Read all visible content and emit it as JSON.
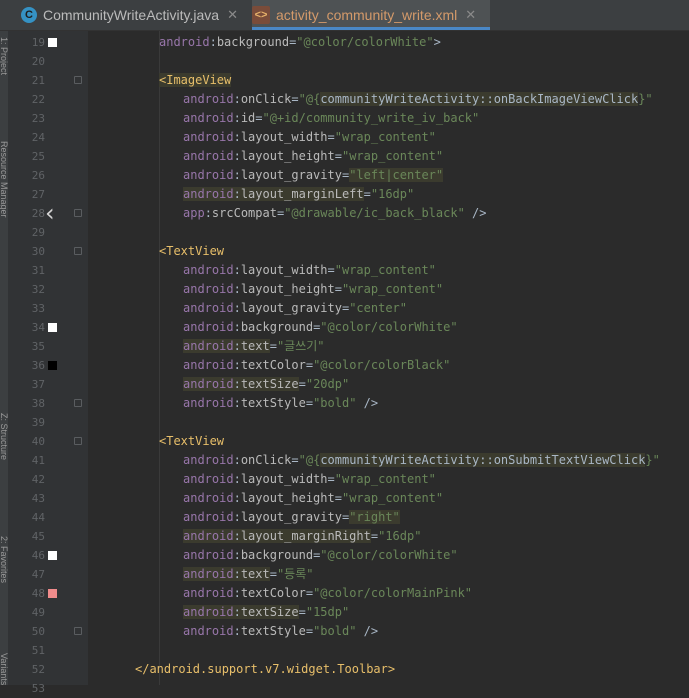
{
  "tabs": [
    {
      "label": "CommunityWriteActivity.java",
      "icon": "java-class-icon",
      "glyph": "C",
      "active": false
    },
    {
      "label": "activity_community_write.xml",
      "icon": "xml-layout-icon",
      "glyph": "<>",
      "active": true
    }
  ],
  "side_panel_labels": [
    "1: Project",
    "Resource Manager",
    "Z: Structure",
    "2: Favorites",
    "Variants"
  ],
  "colors": {
    "tag": "#e8bf6a",
    "namespace": "#9876aa",
    "attribute": "#bababa",
    "value": "#6a8759",
    "background": "#2b2b2b",
    "gutter": "#313335",
    "swatch_white": "#ffffff",
    "swatch_black": "#000000",
    "swatch_pink": "#f08c8c"
  },
  "lines": [
    {
      "num": "19",
      "indent": 2,
      "parts": [
        [
          "ns",
          "android"
        ],
        [
          "plain",
          ":"
        ],
        [
          "attr",
          "background"
        ],
        [
          "plain",
          "="
        ],
        [
          "val",
          "\"@color/colorWhite\""
        ],
        [
          "plain",
          ">"
        ]
      ],
      "swatch": "#ffffff",
      "fold": false
    },
    {
      "num": "20",
      "indent": 0,
      "parts": [],
      "fold": false
    },
    {
      "num": "21",
      "indent": 2,
      "parts": [
        [
          "tag",
          "<ImageView"
        ]
      ],
      "fold": true
    },
    {
      "num": "22",
      "indent": 3,
      "parts": [
        [
          "ns",
          "android"
        ],
        [
          "plain",
          ":"
        ],
        [
          "attr",
          "onClick"
        ],
        [
          "plain",
          "="
        ],
        [
          "val",
          "\"@{"
        ],
        [
          "plain",
          "communityWriteActivity::onBackImageViewClick"
        ],
        [
          "val",
          "}\""
        ]
      ],
      "fold": false
    },
    {
      "num": "23",
      "indent": 3,
      "parts": [
        [
          "ns",
          "android"
        ],
        [
          "plain",
          ":"
        ],
        [
          "attr",
          "id"
        ],
        [
          "plain",
          "="
        ],
        [
          "val",
          "\"@+id/community_write_iv_back\""
        ]
      ],
      "fold": false
    },
    {
      "num": "24",
      "indent": 3,
      "parts": [
        [
          "ns",
          "android"
        ],
        [
          "plain",
          ":"
        ],
        [
          "attr",
          "layout_width"
        ],
        [
          "plain",
          "="
        ],
        [
          "val",
          "\"wrap_content\""
        ]
      ],
      "fold": false
    },
    {
      "num": "25",
      "indent": 3,
      "parts": [
        [
          "ns",
          "android"
        ],
        [
          "plain",
          ":"
        ],
        [
          "attr",
          "layout_height"
        ],
        [
          "plain",
          "="
        ],
        [
          "val",
          "\"wrap_content\""
        ]
      ],
      "fold": false
    },
    {
      "num": "26",
      "indent": 3,
      "parts": [
        [
          "ns",
          "android"
        ],
        [
          "plain",
          ":"
        ],
        [
          "attr",
          "layout_gravity"
        ],
        [
          "plain",
          "="
        ],
        [
          "val",
          "\"left|center\""
        ]
      ],
      "fold": false
    },
    {
      "num": "27",
      "indent": 3,
      "parts": [
        [
          "ns",
          "android"
        ],
        [
          "plain",
          ":"
        ],
        [
          "attr",
          "layout_marginLeft"
        ],
        [
          "plain",
          "="
        ],
        [
          "val",
          "\"16dp\""
        ]
      ],
      "fold": false
    },
    {
      "num": "28",
      "indent": 3,
      "parts": [
        [
          "ns",
          "app"
        ],
        [
          "plain",
          ":"
        ],
        [
          "attr",
          "srcCompat"
        ],
        [
          "plain",
          "="
        ],
        [
          "val",
          "\"@drawable/ic_back_black\""
        ],
        [
          "plain",
          " />"
        ]
      ],
      "fold": true,
      "gutter_icon": "back-arrow-icon"
    },
    {
      "num": "29",
      "indent": 0,
      "parts": [],
      "fold": false
    },
    {
      "num": "30",
      "indent": 2,
      "parts": [
        [
          "tag",
          "<TextView"
        ]
      ],
      "fold": true
    },
    {
      "num": "31",
      "indent": 3,
      "parts": [
        [
          "ns",
          "android"
        ],
        [
          "plain",
          ":"
        ],
        [
          "attr",
          "layout_width"
        ],
        [
          "plain",
          "="
        ],
        [
          "val",
          "\"wrap_content\""
        ]
      ],
      "fold": false
    },
    {
      "num": "32",
      "indent": 3,
      "parts": [
        [
          "ns",
          "android"
        ],
        [
          "plain",
          ":"
        ],
        [
          "attr",
          "layout_height"
        ],
        [
          "plain",
          "="
        ],
        [
          "val",
          "\"wrap_content\""
        ]
      ],
      "fold": false
    },
    {
      "num": "33",
      "indent": 3,
      "parts": [
        [
          "ns",
          "android"
        ],
        [
          "plain",
          ":"
        ],
        [
          "attr",
          "layout_gravity"
        ],
        [
          "plain",
          "="
        ],
        [
          "val",
          "\"center\""
        ]
      ],
      "fold": false
    },
    {
      "num": "34",
      "indent": 3,
      "parts": [
        [
          "ns",
          "android"
        ],
        [
          "plain",
          ":"
        ],
        [
          "attr",
          "background"
        ],
        [
          "plain",
          "="
        ],
        [
          "val",
          "\"@color/colorWhite\""
        ]
      ],
      "swatch": "#ffffff",
      "fold": false
    },
    {
      "num": "35",
      "indent": 3,
      "parts": [
        [
          "ns",
          "android"
        ],
        [
          "plain",
          ":"
        ],
        [
          "attr",
          "text"
        ],
        [
          "plain",
          "="
        ],
        [
          "val",
          "\"글쓰기\""
        ]
      ],
      "fold": false
    },
    {
      "num": "36",
      "indent": 3,
      "parts": [
        [
          "ns",
          "android"
        ],
        [
          "plain",
          ":"
        ],
        [
          "attr",
          "textColor"
        ],
        [
          "plain",
          "="
        ],
        [
          "val",
          "\"@color/colorBlack\""
        ]
      ],
      "swatch": "#000000",
      "fold": false
    },
    {
      "num": "37",
      "indent": 3,
      "parts": [
        [
          "ns",
          "android"
        ],
        [
          "plain",
          ":"
        ],
        [
          "attr",
          "textSize"
        ],
        [
          "plain",
          "="
        ],
        [
          "val",
          "\"20dp\""
        ]
      ],
      "fold": false
    },
    {
      "num": "38",
      "indent": 3,
      "parts": [
        [
          "ns",
          "android"
        ],
        [
          "plain",
          ":"
        ],
        [
          "attr",
          "textStyle"
        ],
        [
          "plain",
          "="
        ],
        [
          "val",
          "\"bold\""
        ],
        [
          "plain",
          " />"
        ]
      ],
      "fold": true
    },
    {
      "num": "39",
      "indent": 0,
      "parts": [],
      "fold": false
    },
    {
      "num": "40",
      "indent": 2,
      "parts": [
        [
          "tag",
          "<TextView"
        ]
      ],
      "fold": true
    },
    {
      "num": "41",
      "indent": 3,
      "parts": [
        [
          "ns",
          "android"
        ],
        [
          "plain",
          ":"
        ],
        [
          "attr",
          "onClick"
        ],
        [
          "plain",
          "="
        ],
        [
          "val",
          "\"@{"
        ],
        [
          "plain",
          "communityWriteActivity::onSubmitTextViewClick"
        ],
        [
          "val",
          "}\""
        ]
      ],
      "fold": false
    },
    {
      "num": "42",
      "indent": 3,
      "parts": [
        [
          "ns",
          "android"
        ],
        [
          "plain",
          ":"
        ],
        [
          "attr",
          "layout_width"
        ],
        [
          "plain",
          "="
        ],
        [
          "val",
          "\"wrap_content\""
        ]
      ],
      "fold": false
    },
    {
      "num": "43",
      "indent": 3,
      "parts": [
        [
          "ns",
          "android"
        ],
        [
          "plain",
          ":"
        ],
        [
          "attr",
          "layout_height"
        ],
        [
          "plain",
          "="
        ],
        [
          "val",
          "\"wrap_content\""
        ]
      ],
      "fold": false
    },
    {
      "num": "44",
      "indent": 3,
      "parts": [
        [
          "ns",
          "android"
        ],
        [
          "plain",
          ":"
        ],
        [
          "attr",
          "layout_gravity"
        ],
        [
          "plain",
          "="
        ],
        [
          "val",
          "\"right\""
        ]
      ],
      "fold": false
    },
    {
      "num": "45",
      "indent": 3,
      "parts": [
        [
          "ns",
          "android"
        ],
        [
          "plain",
          ":"
        ],
        [
          "attr",
          "layout_marginRight"
        ],
        [
          "plain",
          "="
        ],
        [
          "val",
          "\"16dp\""
        ]
      ],
      "fold": false
    },
    {
      "num": "46",
      "indent": 3,
      "parts": [
        [
          "ns",
          "android"
        ],
        [
          "plain",
          ":"
        ],
        [
          "attr",
          "background"
        ],
        [
          "plain",
          "="
        ],
        [
          "val",
          "\"@color/colorWhite\""
        ]
      ],
      "swatch": "#ffffff",
      "fold": false
    },
    {
      "num": "47",
      "indent": 3,
      "parts": [
        [
          "ns",
          "android"
        ],
        [
          "plain",
          ":"
        ],
        [
          "attr",
          "text"
        ],
        [
          "plain",
          "="
        ],
        [
          "val",
          "\"등록\""
        ]
      ],
      "fold": false
    },
    {
      "num": "48",
      "indent": 3,
      "parts": [
        [
          "ns",
          "android"
        ],
        [
          "plain",
          ":"
        ],
        [
          "attr",
          "textColor"
        ],
        [
          "plain",
          "="
        ],
        [
          "val",
          "\"@color/colorMainPink\""
        ]
      ],
      "swatch": "#f08c8c",
      "fold": false
    },
    {
      "num": "49",
      "indent": 3,
      "parts": [
        [
          "ns",
          "android"
        ],
        [
          "plain",
          ":"
        ],
        [
          "attr",
          "textSize"
        ],
        [
          "plain",
          "="
        ],
        [
          "val",
          "\"15dp\""
        ]
      ],
      "fold": false
    },
    {
      "num": "50",
      "indent": 3,
      "parts": [
        [
          "ns",
          "android"
        ],
        [
          "plain",
          ":"
        ],
        [
          "attr",
          "textStyle"
        ],
        [
          "plain",
          "="
        ],
        [
          "val",
          "\"bold\""
        ],
        [
          "plain",
          " />"
        ]
      ],
      "fold": true
    },
    {
      "num": "51",
      "indent": 0,
      "parts": [],
      "fold": false
    },
    {
      "num": "52",
      "indent": 1,
      "parts": [
        [
          "tag",
          "</android.support.v7.widget.Toolbar>"
        ]
      ],
      "fold": false
    },
    {
      "num": "53",
      "indent": 0,
      "parts": [],
      "fold": false
    }
  ]
}
